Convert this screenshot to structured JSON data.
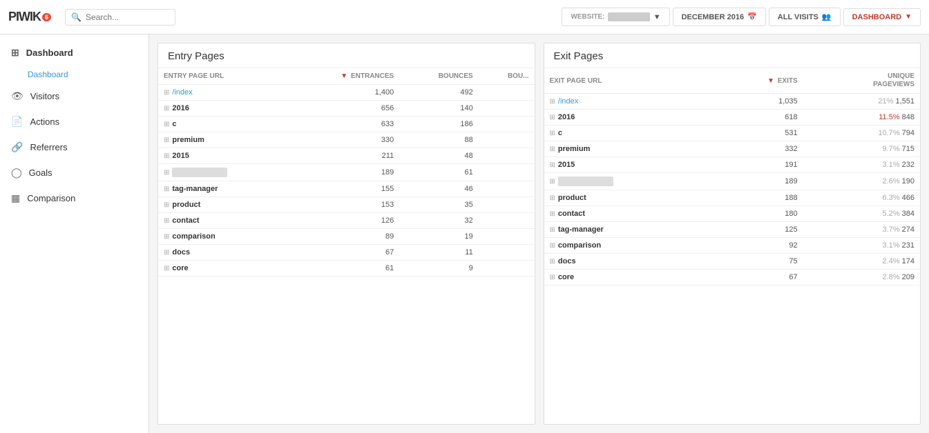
{
  "logo": {
    "text": "PIWIK",
    "pro_badge": "6"
  },
  "search": {
    "placeholder": "Search..."
  },
  "header": {
    "website_label": "WEBSITE:",
    "website_value": "████ ███",
    "date_label": "DECEMBER 2016",
    "segment_label": "ALL VISITS",
    "dashboard_label": "DASHBOARD"
  },
  "sidebar": {
    "items": [
      {
        "id": "dashboard",
        "label": "Dashboard",
        "icon": "⊞"
      },
      {
        "id": "dashboard-sub",
        "label": "Dashboard",
        "sub": true
      },
      {
        "id": "visitors",
        "label": "Visitors",
        "icon": "👁"
      },
      {
        "id": "actions",
        "label": "Actions",
        "icon": "📄"
      },
      {
        "id": "referrers",
        "label": "Referrers",
        "icon": "🔗"
      },
      {
        "id": "goals",
        "label": "Goals",
        "icon": "🎯"
      },
      {
        "id": "comparison",
        "label": "Comparison",
        "icon": "📊"
      }
    ]
  },
  "entry_pages": {
    "title": "Entry Pages",
    "columns": [
      "ENTRY PAGE URL",
      "ENTRANCES",
      "BOUNCES",
      "BOU..."
    ],
    "rows": [
      {
        "url": "/index",
        "link": true,
        "entrances": "1,400",
        "bounces": "492",
        "bounce_rate": ""
      },
      {
        "url": "2016",
        "link": false,
        "entrances": "656",
        "bounces": "140",
        "bounce_rate": ""
      },
      {
        "url": "c",
        "link": false,
        "entrances": "633",
        "bounces": "186",
        "bounce_rate": ""
      },
      {
        "url": "premium",
        "link": false,
        "entrances": "330",
        "bounces": "88",
        "bounce_rate": ""
      },
      {
        "url": "2015",
        "link": false,
        "entrances": "211",
        "bounces": "48",
        "bounce_rate": ""
      },
      {
        "url": "BLURRED",
        "link": false,
        "blurred": true,
        "entrances": "189",
        "bounces": "61",
        "bounce_rate": ""
      },
      {
        "url": "tag-manager",
        "link": false,
        "entrances": "155",
        "bounces": "46",
        "bounce_rate": ""
      },
      {
        "url": "product",
        "link": false,
        "entrances": "153",
        "bounces": "35",
        "bounce_rate": ""
      },
      {
        "url": "contact",
        "link": false,
        "entrances": "126",
        "bounces": "32",
        "bounce_rate": ""
      },
      {
        "url": "comparison",
        "link": false,
        "entrances": "89",
        "bounces": "19",
        "bounce_rate": ""
      },
      {
        "url": "docs",
        "link": false,
        "entrances": "67",
        "bounces": "11",
        "bounce_rate": ""
      },
      {
        "url": "core",
        "link": false,
        "entrances": "61",
        "bounces": "9",
        "bounce_rate": ""
      }
    ]
  },
  "exit_pages": {
    "title": "Exit Pages",
    "columns": [
      "EXIT PAGE URL",
      "EXITS",
      "UNIQUE PAGEVIEWS"
    ],
    "rows": [
      {
        "url": "/index",
        "link": true,
        "exits": "1,035",
        "pct": "21%",
        "pct_color": "gray",
        "unique": "1,551"
      },
      {
        "url": "2016",
        "link": false,
        "exits": "618",
        "pct": "11.5%",
        "pct_color": "red",
        "unique": "848"
      },
      {
        "url": "c",
        "link": false,
        "exits": "531",
        "pct": "10.7%",
        "pct_color": "gray",
        "unique": "794"
      },
      {
        "url": "premium",
        "link": false,
        "exits": "332",
        "pct": "9.7%",
        "pct_color": "gray",
        "unique": "715"
      },
      {
        "url": "2015",
        "link": false,
        "exits": "191",
        "pct": "3.1%",
        "pct_color": "gray",
        "unique": "232"
      },
      {
        "url": "BLURRED",
        "link": false,
        "blurred": true,
        "exits": "189",
        "pct": "2.6%",
        "pct_color": "gray",
        "unique": "190"
      },
      {
        "url": "product",
        "link": false,
        "exits": "188",
        "pct": "6.3%",
        "pct_color": "gray",
        "unique": "466"
      },
      {
        "url": "contact",
        "link": false,
        "exits": "180",
        "pct": "5.2%",
        "pct_color": "gray",
        "unique": "384"
      },
      {
        "url": "tag-manager",
        "link": false,
        "exits": "125",
        "pct": "3.7%",
        "pct_color": "gray",
        "unique": "274"
      },
      {
        "url": "comparison",
        "link": false,
        "exits": "92",
        "pct": "3.1%",
        "pct_color": "gray",
        "unique": "231"
      },
      {
        "url": "docs",
        "link": false,
        "exits": "75",
        "pct": "2.4%",
        "pct_color": "gray",
        "unique": "174"
      },
      {
        "url": "core",
        "link": false,
        "exits": "67",
        "pct": "2.8%",
        "pct_color": "gray",
        "unique": "209"
      }
    ]
  }
}
